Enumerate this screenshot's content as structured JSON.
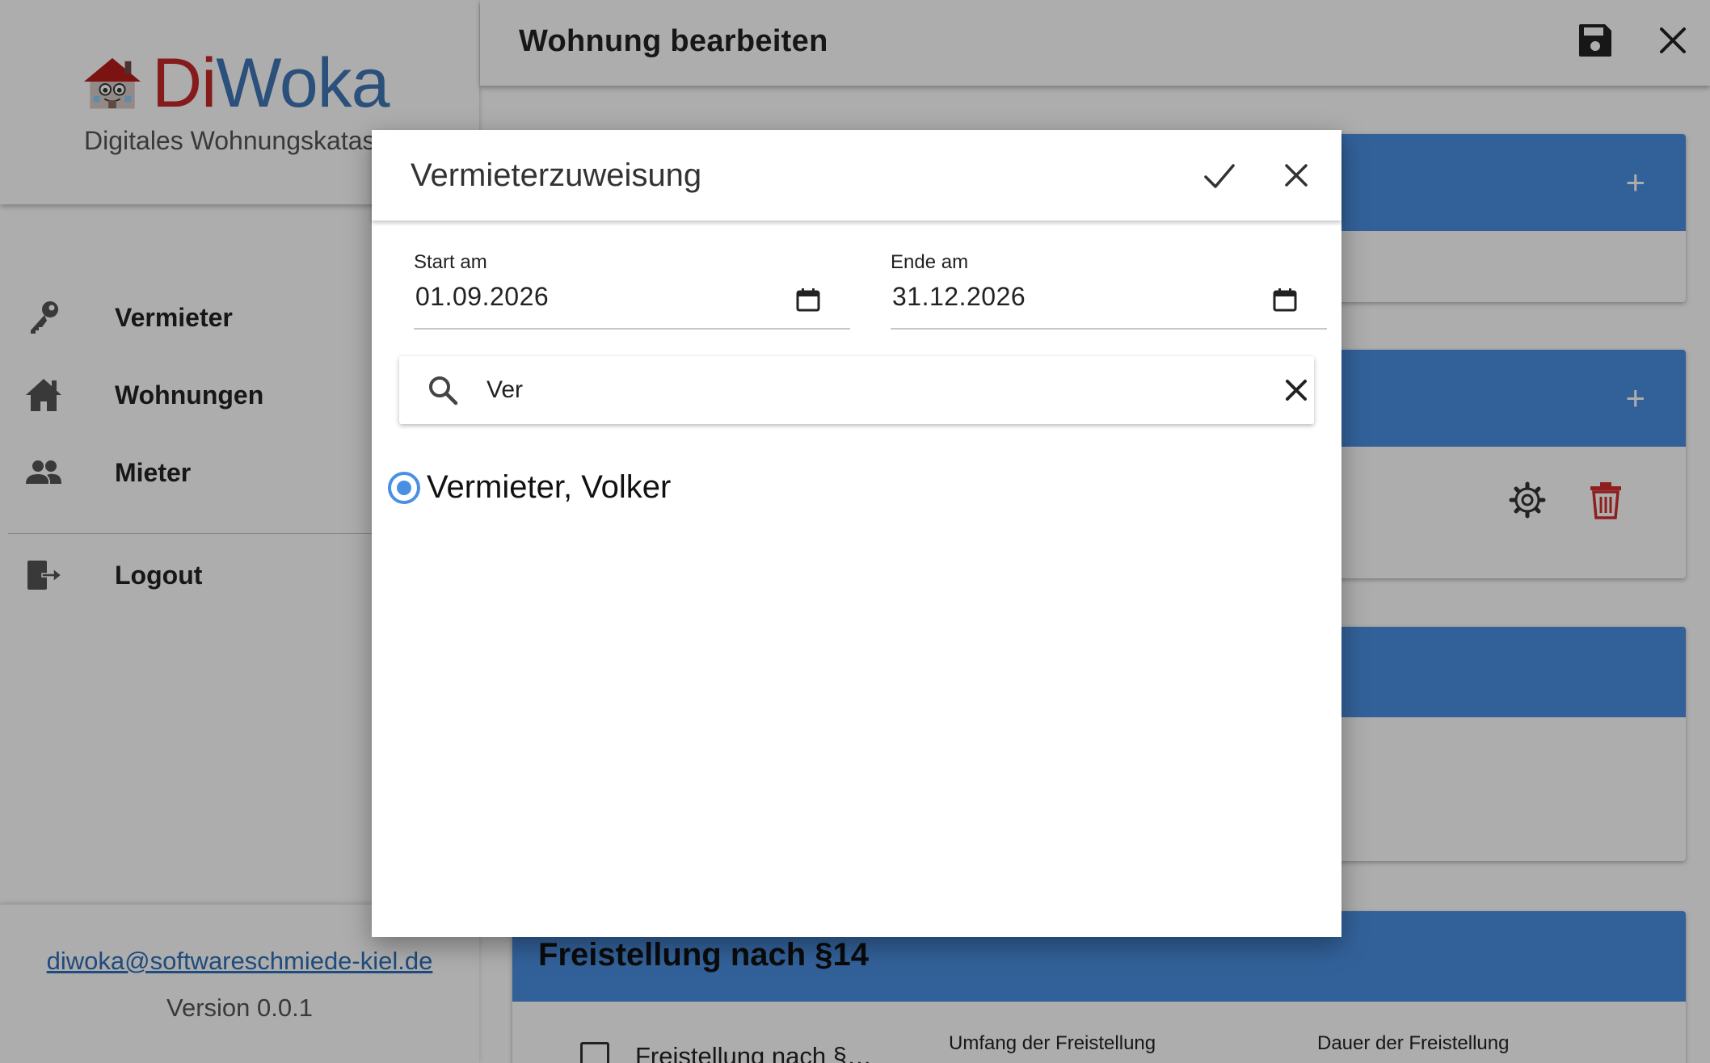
{
  "app": {
    "logo_di": "Di",
    "logo_woka": "Woka",
    "subtitle": "Digitales Wohnungskatas",
    "brand_red": "#c62828",
    "brand_blue": "#3f76b5"
  },
  "sidebar": {
    "items": [
      {
        "label": "Vermieter",
        "icon": "key-icon"
      },
      {
        "label": "Wohnungen",
        "icon": "home-icon"
      },
      {
        "label": "Mieter",
        "icon": "people-icon"
      }
    ],
    "logout": {
      "label": "Logout",
      "icon": "logout-icon"
    },
    "email": "diwoka@softwareschmiede-kiel.de",
    "version": "Version 0.0.1"
  },
  "topbar": {
    "title": "Wohnung bearbeiten",
    "save_icon": "save-icon",
    "close_icon": "close-icon"
  },
  "cards": {
    "plus": "+",
    "header_color": "#4a90e2",
    "freistellung": {
      "title": "Freistellung nach §14",
      "checkbox_label": "Freistellung nach §…",
      "col_umfang": "Umfang der Freistellung",
      "col_dauer": "Dauer der Freistellung"
    }
  },
  "dialog": {
    "title": "Vermieterzuweisung",
    "start": {
      "label": "Start am",
      "value": "01.09.2026"
    },
    "end": {
      "label": "Ende am",
      "value": "31.12.2026"
    },
    "search": {
      "value": "Ver"
    },
    "results": [
      {
        "label": "Vermieter, Volker",
        "selected": true
      }
    ],
    "accent": "#4a90e2"
  }
}
